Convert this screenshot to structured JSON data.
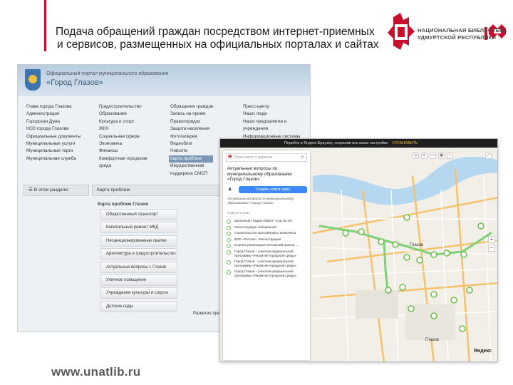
{
  "slide": {
    "title_line1": "Подача обращений граждан посредством интернет-приемных",
    "title_line2": "и сервисов, размещенных на официальных порталах и сайтах",
    "website": "www.unatlib.ru",
    "accent_color": "#c8102e"
  },
  "logo": {
    "line1": "НАЦИОНАЛЬНАЯ БИБЛИОТЕКА",
    "line2": "УДМУРТСКОЙ РЕСПУБЛИКИ",
    "emblem_color": "#c8102e",
    "icon": "udmurt-ornament-icon"
  },
  "portal": {
    "subtitle": "Официальный портал муниципального образования",
    "title": "«Город Глазов»",
    "menu": {
      "col1": [
        "Глава города Глазова",
        "Администрация",
        "Городская Дума",
        "КСО города Глазова",
        "Официальные документы",
        "Муниципальные услуги",
        "Муниципальные торги",
        "Муниципальная служба"
      ],
      "col2": [
        "Градостроительство",
        "Образование",
        "Культура и спорт",
        "ЖКХ",
        "Социальная сфера",
        "Экономика",
        "Финансы",
        "Комфортная городская",
        "среда"
      ],
      "col3": [
        "Обращения граждан",
        "Запись на прием",
        "Правопорядок",
        "Защита населения",
        "Фотогалерея",
        "Видеоблог",
        "Новости",
        "Карта проблем",
        "Имущественная",
        "поддержка СМСП"
      ],
      "col4": [
        "Пресс-центр",
        "Наши люди",
        "Наши предприятия и",
        "учреждения",
        "Информационные системы"
      ],
      "highlighted": "Карта проблем"
    },
    "section_label": "В этом разделе:",
    "breadcrumb": "Карта проблем",
    "section_title": "Карта проблем Глазов",
    "categories": [
      "Общественный транспорт",
      "Капитальный ремонт МКД",
      "Несанкционированные свалки",
      "Архитектура и градостроительство",
      "Актуальные вопросы г. Глазов",
      "Уличное освещение",
      "Учреждения культуры и спорта",
      "Детские сады"
    ],
    "develop_label": "Развитие предпринима..."
  },
  "map": {
    "topbar_text": "Перейти в Яндекс.Браузер, сохранив все ваши настройки",
    "topbar_action": "УСТАНОВИТЬ",
    "search_placeholder": "Поиск мест и адресов",
    "panel_title": "Актуальные вопросы по муниципальному образованию «Город Глазов»",
    "create_button": "Создать новую карту",
    "description": "Актуальные вопросы по муниципальному образованию «Город Глазов»",
    "date": "9 августа 2017",
    "items": [
      "Школьный стадион МБОУ «СШ № 10»",
      "Реконструкция набережной",
      "Строительство Бассейнового комплекса",
      "ФОК «Россия». Реконструкция",
      "В целях реализации положений Закона ...",
      "Город Глазов – участник федеральной программы «Развитие городской среды»",
      "Город Глазов – участник федеральной программы «Развитие городской среды»",
      "Город Глазов – участник федеральной программы «Развитие городской среды»"
    ],
    "city_label": "Глазов",
    "yandex_label": "Яндекс",
    "zoom_in": "+",
    "zoom_out": "−",
    "road_color": "#f5c26b",
    "river_color": "#b5d7ef",
    "marker_color": "#6fbf4f"
  }
}
